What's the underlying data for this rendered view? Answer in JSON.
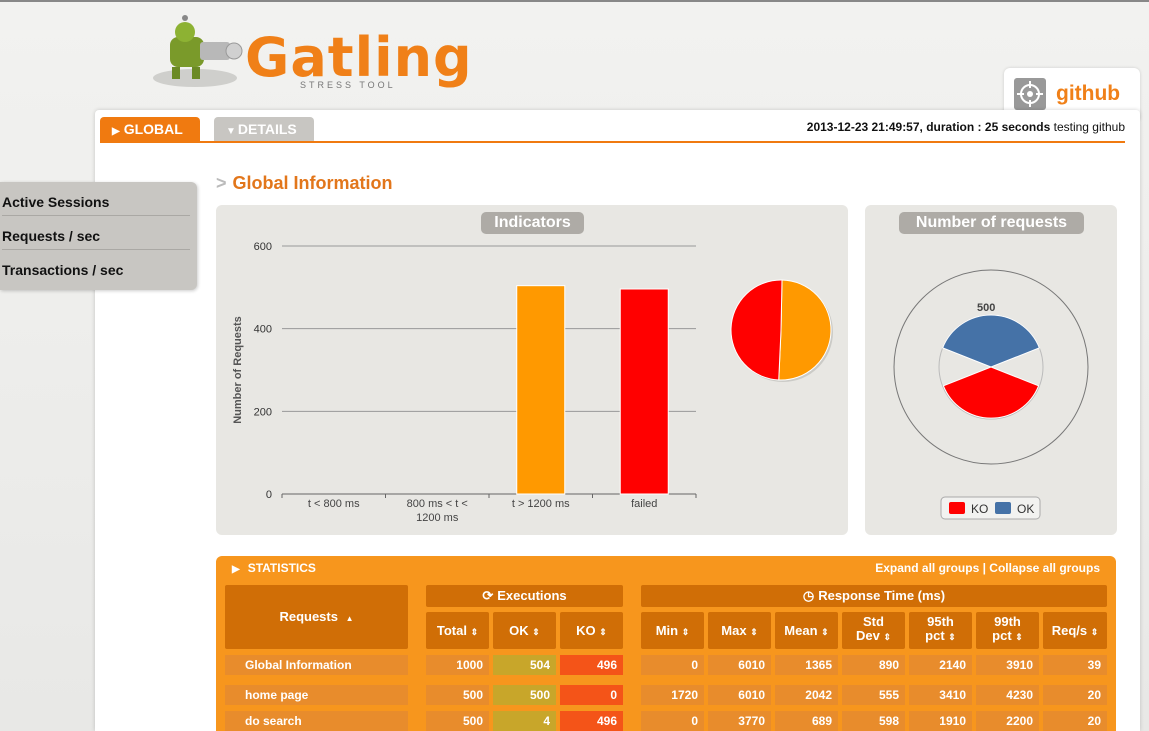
{
  "header": {
    "logo_text": "Gatling",
    "logo_subtitle": "STRESS TOOL",
    "simulation_name": "github"
  },
  "tabs": [
    {
      "label": "GLOBAL",
      "icon": "triangle-right-icon",
      "active": true
    },
    {
      "label": "DETAILS",
      "icon": "triangle-down-icon",
      "active": false
    }
  ],
  "run_info": {
    "datetime": "2013-12-23 21:49:57",
    "duration_label": ", duration :",
    "duration": "25 seconds",
    "description": "testing github"
  },
  "sidebar": {
    "items": [
      {
        "label": "Active Sessions"
      },
      {
        "label": "Requests / sec"
      },
      {
        "label": "Transactions / sec"
      }
    ]
  },
  "section": {
    "prefix": ">",
    "title": "Global Information"
  },
  "indicators_panel": {
    "title": "Indicators"
  },
  "requests_panel": {
    "title": "Number of requests"
  },
  "chart_data": [
    {
      "type": "bar",
      "title": "Indicators",
      "ylabel": "Number of Requests",
      "categories": [
        "t < 800 ms",
        "800 ms < t < 1200 ms",
        "t > 1200 ms",
        "failed"
      ],
      "category_lines": [
        [
          "t < 800 ms"
        ],
        [
          "800 ms < t <",
          "1200 ms"
        ],
        [
          "t > 1200 ms"
        ],
        [
          "failed"
        ]
      ],
      "values": [
        0,
        0,
        504,
        496
      ],
      "colors": [
        "#4caf50",
        "#ffdd00",
        "#ff9900",
        "#ff0000"
      ],
      "ylim": [
        0,
        600
      ],
      "yticks": [
        0,
        200,
        400,
        600
      ],
      "grid": true
    },
    {
      "type": "pie",
      "slices": [
        {
          "label": "t > 1200 ms",
          "value": 504,
          "color": "#ff9900"
        },
        {
          "label": "failed",
          "value": 496,
          "color": "#ff0000"
        }
      ]
    },
    {
      "type": "pie",
      "title": "Number of requests",
      "subtype": "polar",
      "max_label": "500",
      "series": [
        {
          "name": "KO",
          "value": 496,
          "color": "#ff0000"
        },
        {
          "name": "OK",
          "value": 504,
          "color": "#4572a7"
        }
      ],
      "legend_position": "bottom"
    }
  ],
  "statistics": {
    "title": "STATISTICS",
    "expand_label": "Expand all groups",
    "separator": "|",
    "collapse_label": "Collapse all groups",
    "group_executions": "Executions",
    "group_response_time": "Response Time (ms)",
    "columns": {
      "requests": "Requests",
      "total": "Total",
      "ok": "OK",
      "ko": "KO",
      "min": "Min",
      "max": "Max",
      "mean": "Mean",
      "std_dev_1": "Std",
      "std_dev_2": "Dev",
      "p95_1": "95th",
      "p95_2": "pct",
      "p99_1": "99th",
      "p99_2": "pct",
      "reqs": "Req/s"
    },
    "rows": [
      {
        "name": "Global Information",
        "total": "1000",
        "ok": "504",
        "ko": "496",
        "min": "0",
        "max": "6010",
        "mean": "1365",
        "std": "890",
        "p95": "2140",
        "p99": "3910",
        "rps": "39"
      },
      {
        "name": "home page",
        "total": "500",
        "ok": "500",
        "ko": "0",
        "min": "1720",
        "max": "6010",
        "mean": "2042",
        "std": "555",
        "p95": "3410",
        "p99": "4230",
        "rps": "20"
      },
      {
        "name": "do search",
        "total": "500",
        "ok": "4",
        "ko": "496",
        "min": "0",
        "max": "3770",
        "mean": "689",
        "std": "598",
        "p95": "1910",
        "p99": "2200",
        "rps": "20"
      }
    ]
  }
}
